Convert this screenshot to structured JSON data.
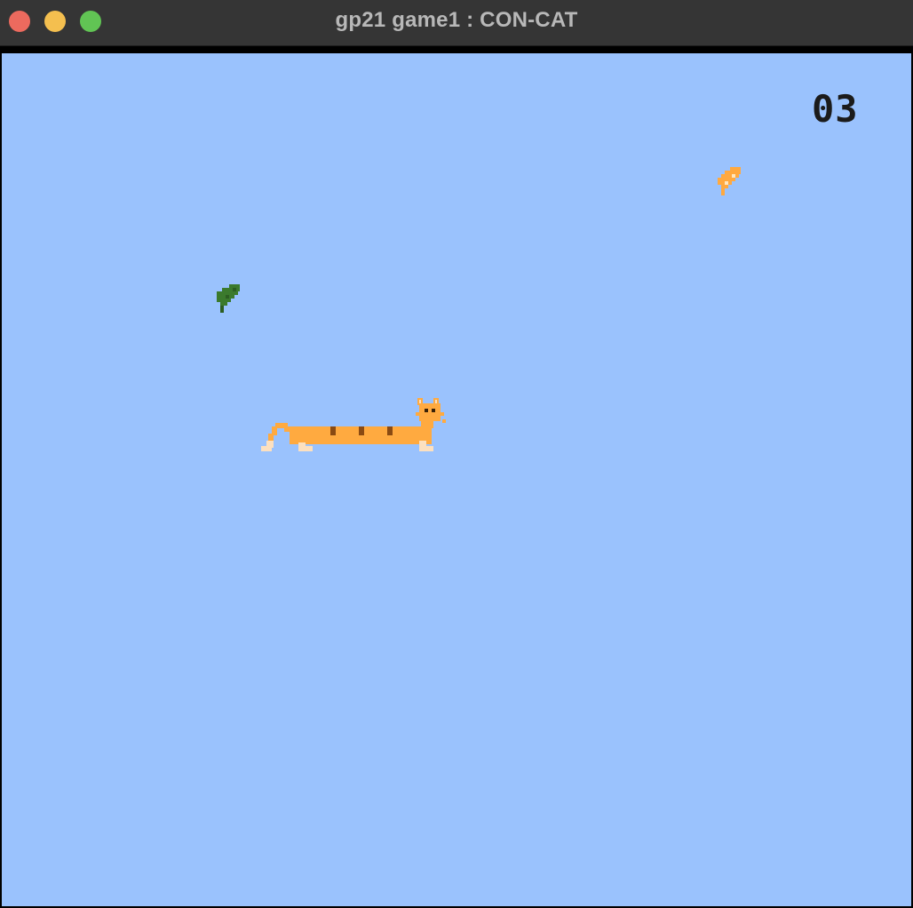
{
  "window": {
    "title": "gp21 game1 : CON-CAT",
    "buttons": [
      "close",
      "minimize",
      "maximize"
    ]
  },
  "game": {
    "score": "03",
    "background_color": "#9ac2fd",
    "items": [
      {
        "name": "fish-treat",
        "color": "#ffa940"
      },
      {
        "name": "leaf-item",
        "color": "#3b7a2d"
      }
    ],
    "player": {
      "name": "long-cat",
      "body_color": "#ffaa40",
      "stripe_color": "#8a4a12",
      "paw_color": "#fce0c0"
    }
  }
}
